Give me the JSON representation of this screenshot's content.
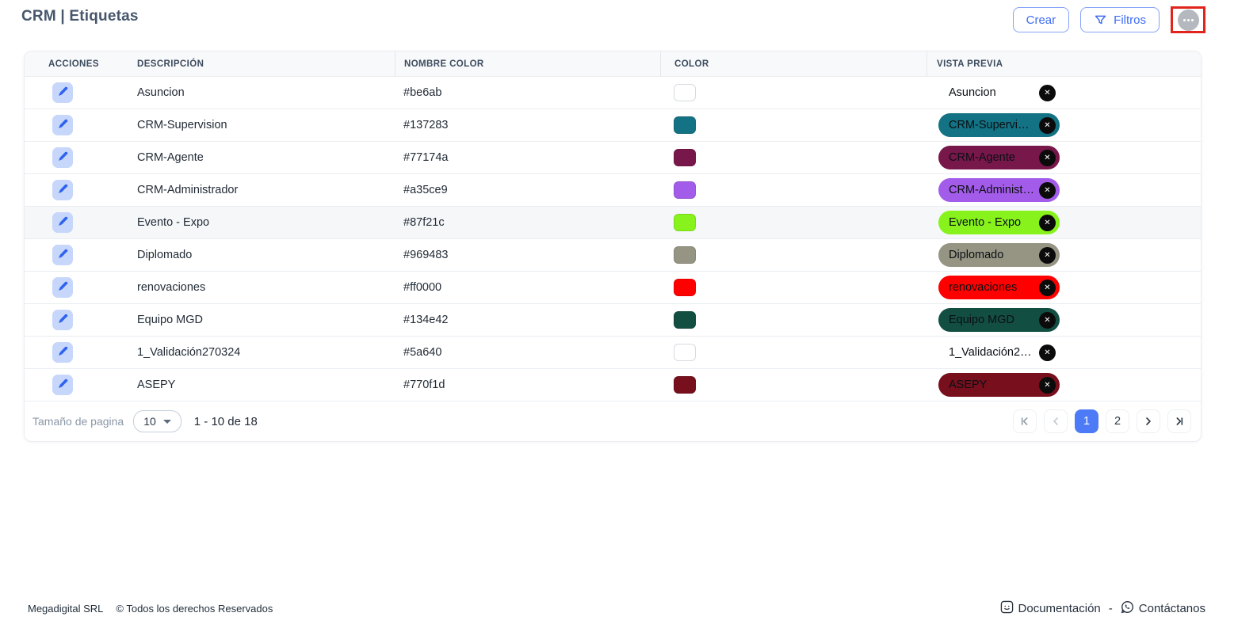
{
  "page": {
    "title": "CRM | Etiquetas"
  },
  "toolbar": {
    "crear_label": "Crear",
    "filtros_label": "Filtros",
    "icons": {
      "filter": "funnel-icon",
      "more": "ellipsis-icon"
    },
    "highlight_box_color": "#e0241c"
  },
  "table": {
    "headers": [
      "ACCIONES",
      "DESCRIPCIÓN",
      "NOMBRE COLOR",
      "COLOR",
      "VISTA PREVIA"
    ],
    "rows": [
      {
        "description": "Asuncion",
        "color_name": "#be6ab",
        "swatch": "",
        "chip_bg": "",
        "highlighted": false
      },
      {
        "description": "CRM-Supervision",
        "color_name": "#137283",
        "swatch": "#137283",
        "chip_bg": "#137283",
        "highlighted": false
      },
      {
        "description": "CRM-Agente",
        "color_name": "#77174a",
        "swatch": "#77174a",
        "chip_bg": "#77174a",
        "highlighted": false
      },
      {
        "description": "CRM-Administrador",
        "color_name": "#a35ce9",
        "swatch": "#a35ce9",
        "chip_bg": "#a35ce9",
        "highlighted": false
      },
      {
        "description": "Evento - Expo",
        "color_name": "#87f21c",
        "swatch": "#87f21c",
        "chip_bg": "#87f21c",
        "highlighted": true
      },
      {
        "description": "Diplomado",
        "color_name": "#969483",
        "swatch": "#969483",
        "chip_bg": "#969483",
        "highlighted": false
      },
      {
        "description": "renovaciones",
        "color_name": "#ff0000",
        "swatch": "#ff0000",
        "chip_bg": "#ff0000",
        "highlighted": false
      },
      {
        "description": "Equipo MGD",
        "color_name": "#134e42",
        "swatch": "#134e42",
        "chip_bg": "#134e42",
        "highlighted": false
      },
      {
        "description": "1_Validación270324",
        "color_name": "#5a640",
        "swatch": "",
        "chip_bg": "",
        "highlighted": false
      },
      {
        "description": "ASEPY",
        "color_name": "#770f1d",
        "swatch": "#770f1d",
        "chip_bg": "#770f1d",
        "highlighted": false
      }
    ],
    "chip_close_glyph": "✕"
  },
  "pagination": {
    "page_size_label": "Tamaño de pagina",
    "page_size_value": "10",
    "range_text": "1 - 10 de 18",
    "pages": [
      "1",
      "2"
    ],
    "active_page": "1",
    "icons": {
      "first": "first-page-icon",
      "prev": "chevron-left-icon",
      "next": "chevron-right-icon",
      "last": "last-page-icon"
    }
  },
  "footer": {
    "company": "Megadigital SRL",
    "copyright": "© Todos los derechos Reservados",
    "docs_label": "Documentación",
    "separator": "-",
    "contact_label": "Contáctanos",
    "icons": {
      "docs": "documentation-icon",
      "contact": "whatsapp-contact-icon"
    }
  },
  "colors": {
    "accent_blue": "#3e6cf3",
    "active_page_bg": "#4d7bf7",
    "highlight_red": "#e0241c",
    "edit_button_bg": "#c7d6fb",
    "header_bg": "#f8f9fb"
  }
}
